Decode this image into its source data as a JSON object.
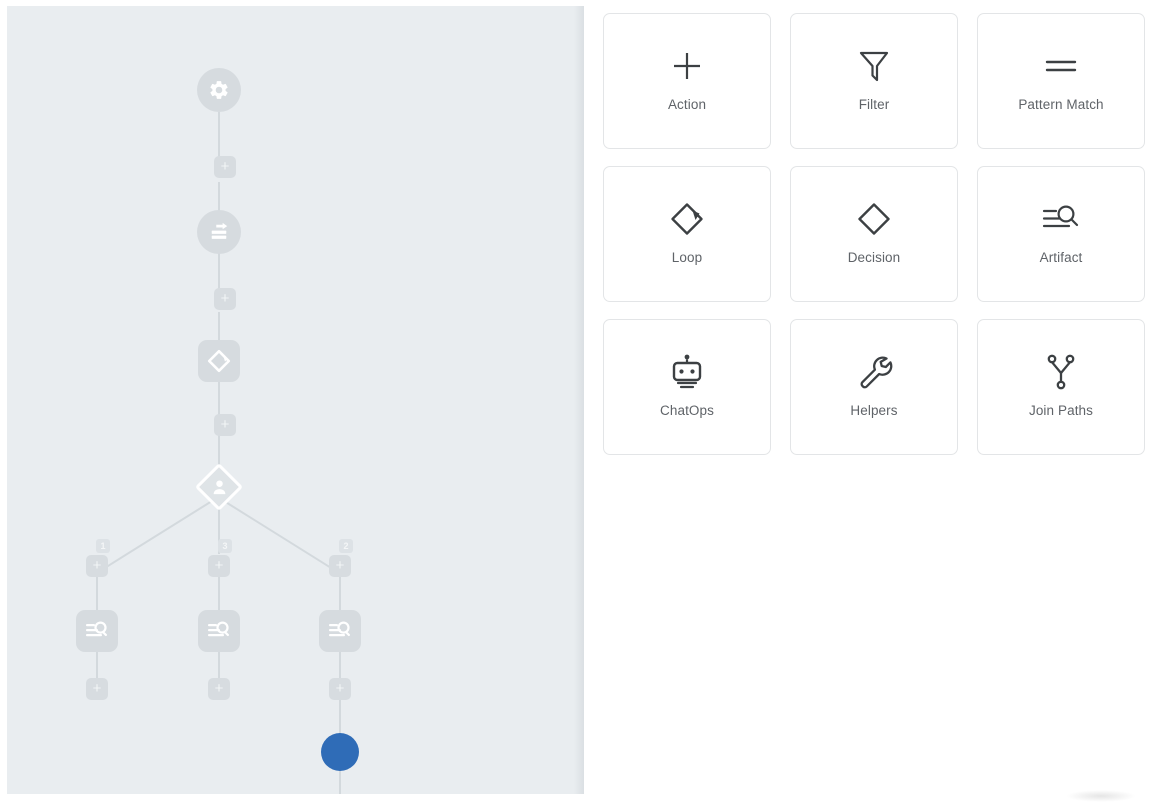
{
  "canvas": {
    "name": "workflow-canvas",
    "background_color": "#e9edf0",
    "edge_color": "#d3d9dd",
    "node_color": "#d6dbdf",
    "drag_handle_color": "#2f6cb7",
    "add_button_label": "+",
    "nodes": [
      {
        "id": "start",
        "type": "settings",
        "icon": "gear-icon",
        "shape": "circle"
      },
      {
        "id": "pattern",
        "type": "pattern-match",
        "icon": "pattern-match-icon",
        "shape": "circle"
      },
      {
        "id": "loop",
        "type": "loop",
        "icon": "loop-icon",
        "shape": "rounded-square"
      },
      {
        "id": "decision",
        "type": "decision",
        "icon": "user-decision-icon",
        "shape": "diamond"
      },
      {
        "id": "artifact-1",
        "type": "artifact",
        "icon": "artifact-icon",
        "shape": "rounded-square"
      },
      {
        "id": "artifact-2",
        "type": "artifact",
        "icon": "artifact-icon",
        "shape": "rounded-square"
      },
      {
        "id": "artifact-3",
        "type": "artifact",
        "icon": "artifact-icon",
        "shape": "rounded-square"
      }
    ],
    "branch_badges": [
      {
        "id": "branch-1",
        "label": "1"
      },
      {
        "id": "branch-3",
        "label": "3"
      },
      {
        "id": "branch-2",
        "label": "2"
      }
    ]
  },
  "palette": {
    "name": "node-palette",
    "columns": 3,
    "cards": [
      {
        "label": "Action",
        "icon": "plus-icon"
      },
      {
        "label": "Filter",
        "icon": "funnel-icon"
      },
      {
        "label": "Pattern Match",
        "icon": "equals-icon"
      },
      {
        "label": "Loop",
        "icon": "loop-icon"
      },
      {
        "label": "Decision",
        "icon": "diamond-icon"
      },
      {
        "label": "Artifact",
        "icon": "artifact-search-icon"
      },
      {
        "label": "ChatOps",
        "icon": "robot-icon"
      },
      {
        "label": "Helpers",
        "icon": "wrench-icon"
      },
      {
        "label": "Join Paths",
        "icon": "join-paths-icon"
      }
    ]
  },
  "colors": {
    "canvas_bg": "#e9edf0",
    "panel_bg": "#ffffff",
    "card_border": "#e3e5e7",
    "label_text": "#5f6368",
    "icon_stroke": "#3c4043",
    "accent_blue": "#2f6cb7"
  }
}
